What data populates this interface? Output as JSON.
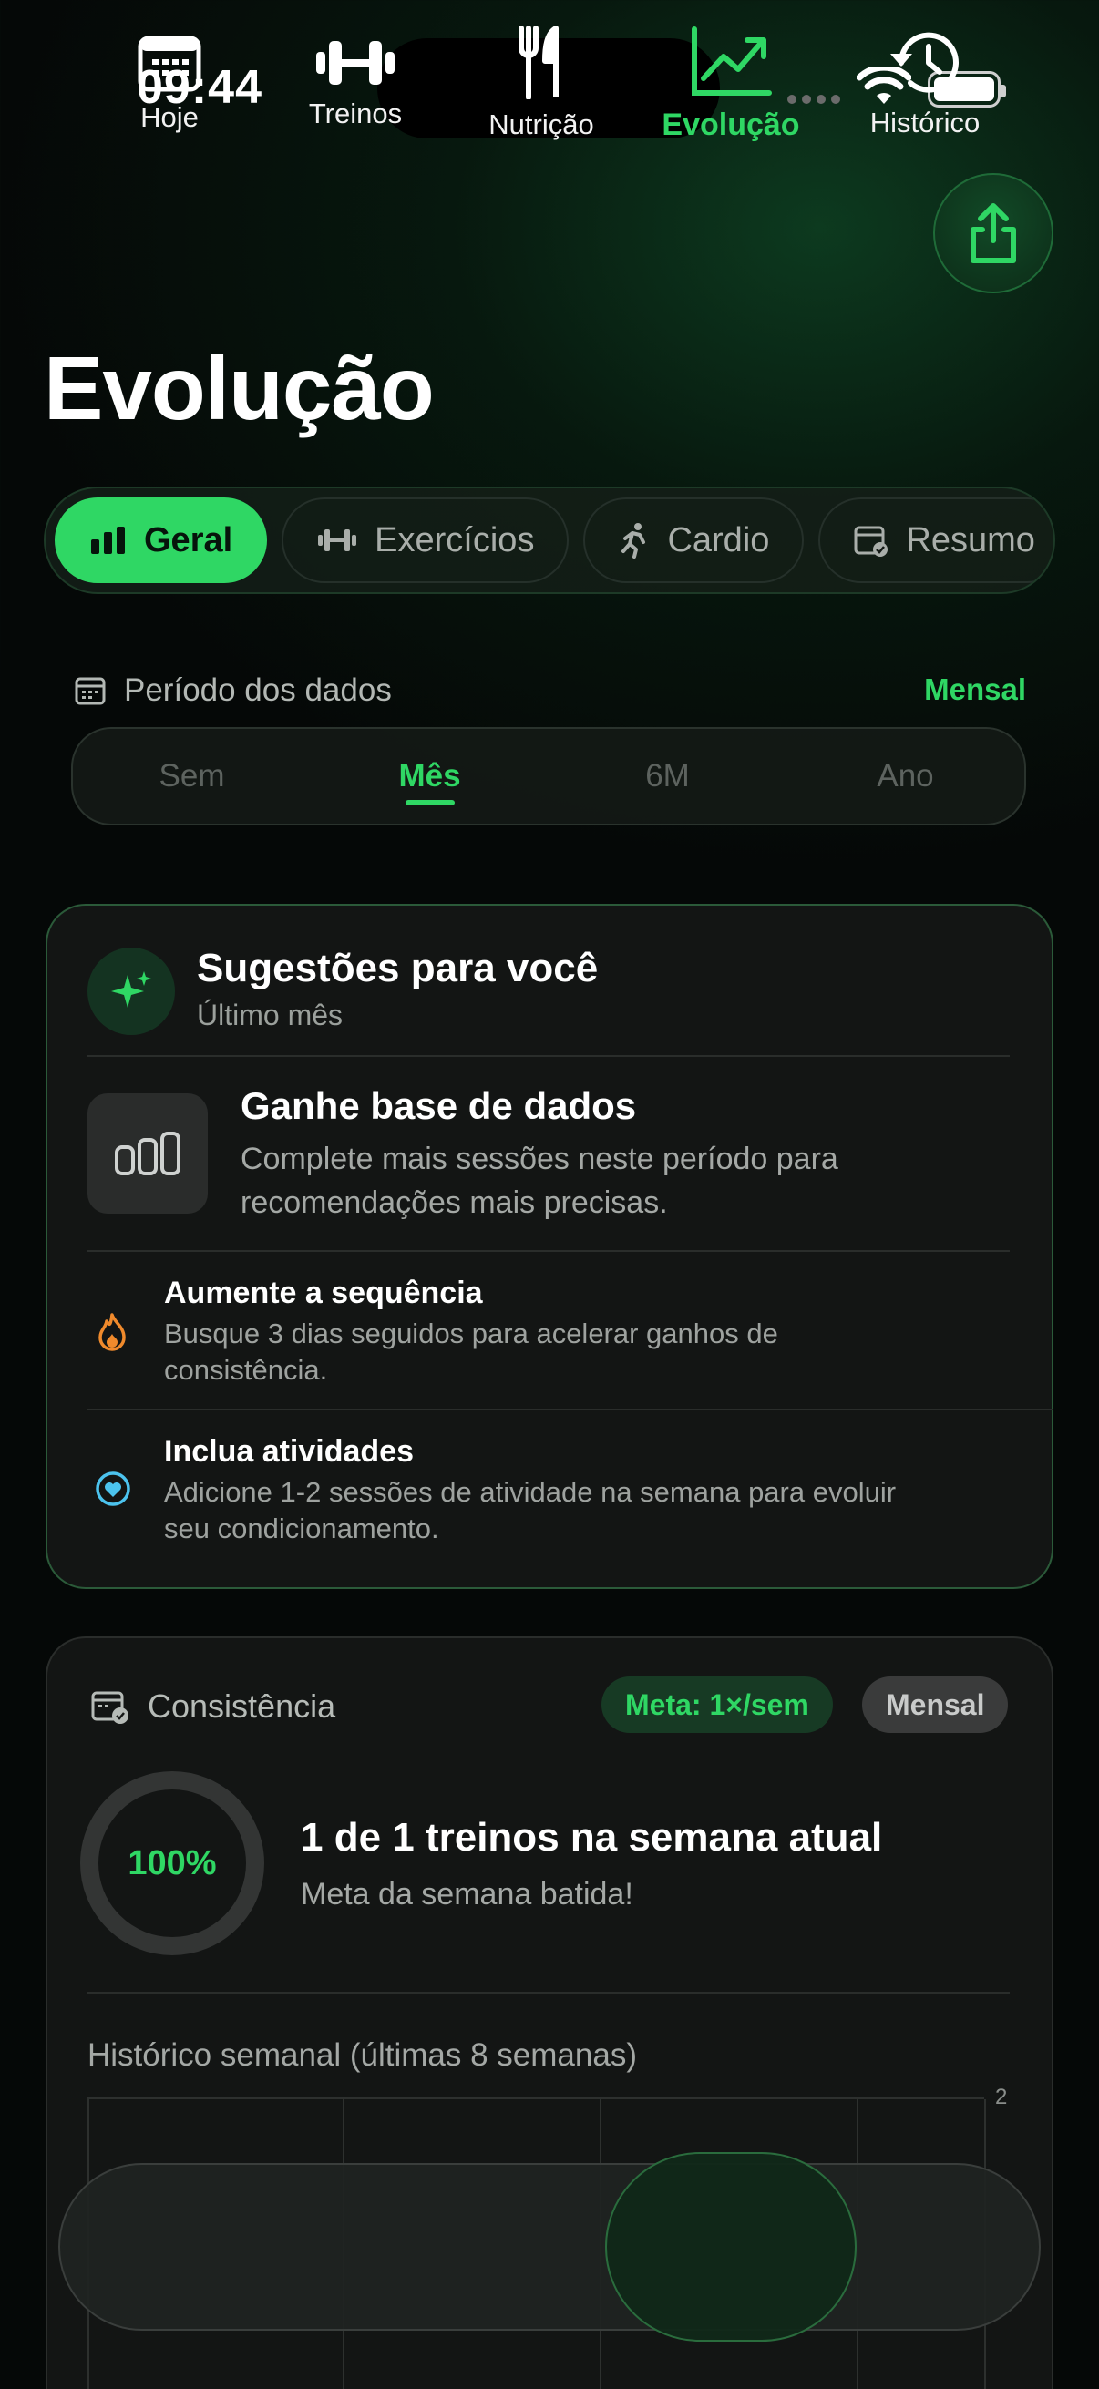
{
  "status_bar": {
    "time": "09:44"
  },
  "header": {
    "title": "Evolução",
    "share_icon": "share-icon"
  },
  "tabs": [
    {
      "label": "Geral",
      "icon": "bar-chart-icon",
      "active": true
    },
    {
      "label": "Exercícios",
      "icon": "dumbbell-icon",
      "active": false
    },
    {
      "label": "Cardio",
      "icon": "running-icon",
      "active": false
    },
    {
      "label": "Resumo",
      "icon": "calendar-check-icon",
      "active": false
    }
  ],
  "period": {
    "label": "Período dos dados",
    "mode": "Mensal",
    "options": [
      "Sem",
      "Mês",
      "6M",
      "Ano"
    ],
    "selected": "Mês"
  },
  "suggestions": {
    "title": "Sugestões para você",
    "subtitle": "Último mês",
    "highlight": {
      "title": "Ganhe base de dados",
      "description": "Complete mais sessões neste período para recomendações mais precisas."
    },
    "tips": [
      {
        "title": "Aumente a sequência",
        "description": "Busque 3 dias seguidos para acelerar ganhos de consistência.",
        "icon": "flame-icon",
        "color": "#f08a2c"
      },
      {
        "title": "Inclua atividades",
        "description": "Adicione 1-2 sessões de atividade na semana para evoluir seu condicionamento.",
        "icon": "heart-icon",
        "color": "#4cc3ee"
      }
    ]
  },
  "consistency": {
    "title": "Consistência",
    "goal_badge": "Meta: 1×/sem",
    "period_badge": "Mensal",
    "progress_text": "100%",
    "progress": 1.0,
    "headline": "1 de 1 treinos na semana atual",
    "subline": "Meta da semana batida!",
    "history_label": "Histórico semanal (últimas 8 semanas)",
    "axis_max": "2"
  },
  "bottom_nav": [
    {
      "label": "Hoje",
      "icon": "calendar-icon",
      "active": false
    },
    {
      "label": "Treinos",
      "icon": "dumbbell-icon",
      "active": false
    },
    {
      "label": "Nutrição",
      "icon": "fork-knife-icon",
      "active": false
    },
    {
      "label": "Evolução",
      "icon": "trend-up-icon",
      "active": true
    },
    {
      "label": "Histórico",
      "icon": "history-icon",
      "active": false
    }
  ],
  "colors": {
    "accent": "#2fd764",
    "background": "#050706",
    "card": "#141615"
  }
}
